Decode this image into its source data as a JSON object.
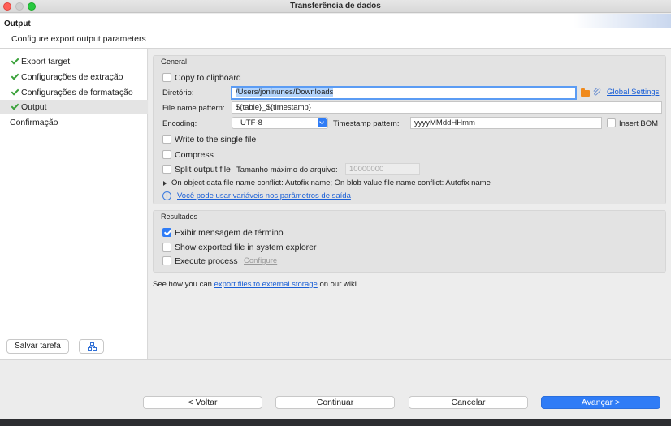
{
  "window": {
    "title": "Transferência de dados"
  },
  "header": {
    "title": "Output",
    "subtitle": "Configure export output parameters"
  },
  "sidebar": {
    "items": [
      {
        "label": "Export target",
        "done": true
      },
      {
        "label": "Configurações de extração",
        "done": true
      },
      {
        "label": "Configurações de formatação",
        "done": true
      },
      {
        "label": "Output",
        "done": true,
        "selected": true
      },
      {
        "label": "Confirmação",
        "done": false
      }
    ],
    "save_task_label": "Salvar tarefa",
    "tree_icon": "hierarchy-icon"
  },
  "general": {
    "title": "General",
    "copy_to_clipboard": {
      "label": "Copy to clipboard",
      "checked": false
    },
    "directory": {
      "label": "Diretório:",
      "value": "/Users/joninunes/Downloads",
      "global_settings_label": "Global Settings"
    },
    "file_name_pattern": {
      "label": "File name pattern:",
      "value": "${table}_${timestamp}"
    },
    "encoding": {
      "label": "Encoding:",
      "value": "UTF-8"
    },
    "timestamp_pattern": {
      "label": "Timestamp pattern:",
      "value": "yyyyMMddHHmm"
    },
    "insert_bom": {
      "label": "Insert BOM",
      "checked": false
    },
    "write_single_file": {
      "label": "Write to the single file",
      "checked": false
    },
    "compress": {
      "label": "Compress",
      "checked": false
    },
    "split_output": {
      "label": "Split output file",
      "checked": false,
      "max_size_label": "Tamanho máximo do arquivo:",
      "max_size_value": "10000000"
    },
    "conflict_text": "On object data file name conflict: Autofix name; On blob value file name conflict: Autofix name",
    "variables_link": "Você pode usar variáveis nos parâmetros de saída"
  },
  "results": {
    "title": "Resultados",
    "show_finish_message": {
      "label": "Exibir mensagem de término",
      "checked": true
    },
    "show_in_explorer": {
      "label": "Show exported file in system explorer",
      "checked": false
    },
    "execute_process": {
      "label": "Execute process",
      "checked": false,
      "configure_label": "Configure"
    }
  },
  "wiki": {
    "prefix": "See how you can",
    "link": "export files to external storage",
    "suffix": "on our wiki"
  },
  "footer": {
    "back": "< Voltar",
    "continue": "Continuar",
    "cancel": "Cancelar",
    "next": "Avançar >"
  },
  "colors": {
    "accent": "#2f7cf6",
    "check_green": "#3aa13a",
    "folder": "#f08a1c",
    "link": "#1a5fd6"
  }
}
